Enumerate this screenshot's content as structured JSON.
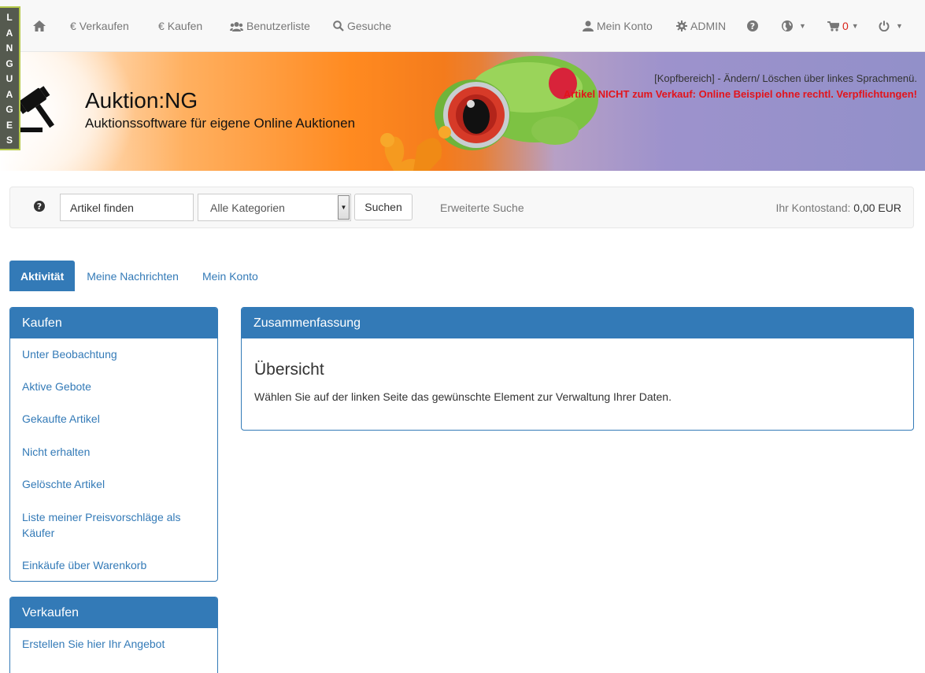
{
  "languages_tab": [
    "L",
    "A",
    "N",
    "G",
    "U",
    "A",
    "G",
    "E",
    "S"
  ],
  "nav": {
    "verkaufen": "Verkaufen",
    "kaufen": "Kaufen",
    "benutzerliste": "Benutzerliste",
    "gesuche": "Gesuche",
    "mein_konto": "Mein Konto",
    "admin": "ADMIN",
    "cart_count": "0"
  },
  "banner": {
    "title": "Auktion:NG",
    "subtitle": "Auktionssoftware für eigene Online Auktionen",
    "note": "[Kopfbereich] - Ändern/ Löschen über linkes Sprachmenü.",
    "warning": "Artikel NICHT zum Verkauf: Online Beispiel ohne rechtl. Verpflichtungen!"
  },
  "search": {
    "input_value": "Artikel finden",
    "category": "Alle Kategorien",
    "button": "Suchen",
    "advanced": "Erweiterte Suche",
    "balance_label": "Ihr Kontostand:",
    "balance_value": "0,00 EUR"
  },
  "tabs": [
    "Aktivität",
    "Meine Nachrichten",
    "Mein Konto"
  ],
  "kaufen_panel": {
    "title": "Kaufen",
    "items": [
      "Unter Beobachtung",
      "Aktive Gebote",
      "Gekaufte Artikel",
      "Nicht erhalten",
      "Gelöschte Artikel",
      "Liste meiner Preisvorschläge als Käufer",
      "Einkäufe über Warenkorb"
    ]
  },
  "verkaufen_panel": {
    "title": "Verkaufen",
    "items": [
      "Erstellen Sie hier Ihr Angebot"
    ]
  },
  "summary": {
    "title": "Zusammenfassung",
    "heading": "Übersicht",
    "text": "Wählen Sie auf der linken Seite das gewünschte Element zur Verwaltung Ihrer Daten."
  },
  "colors": {
    "primary": "#337ab7",
    "warning": "#e3141b",
    "lang_tab_border": "#b5c94a"
  }
}
